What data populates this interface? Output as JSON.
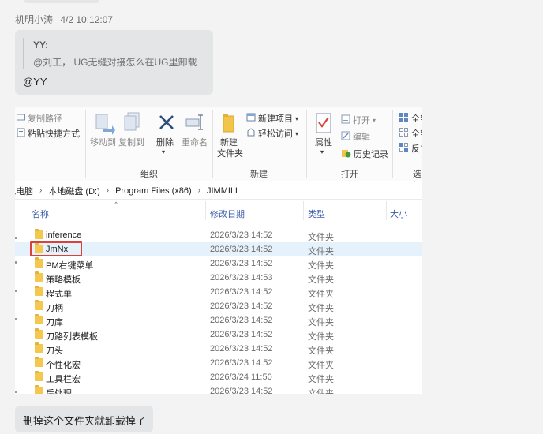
{
  "message": {
    "sender": "机明小涛",
    "time": "4/2 10:12:07",
    "quote_author": "YY:",
    "quote_text": "@刘工， UG无缝对接怎么在UG里卸载",
    "reply": "@YY"
  },
  "ribbon": {
    "copy_path": "复制路径",
    "paste_shortcut": "粘贴快捷方式",
    "move_to": "移动到",
    "copy_to": "复制到",
    "delete": "删除",
    "rename": "重命名",
    "new_item": "新建项目",
    "easy_access": "轻松访问",
    "new_folder_line1": "新建",
    "new_folder_line2": "文件夹",
    "properties": "属性",
    "open": "打开",
    "edit": "编辑",
    "history": "历史记录",
    "select_all": "全部",
    "select_none": "全部",
    "invert": "反向",
    "group_organize": "组织",
    "group_new": "新建",
    "group_open": "打开",
    "group_select": "选择"
  },
  "address": {
    "crumbs": [
      "此电脑",
      "本地磁盘 (D:)",
      "Program Files (x86)",
      "JIMMILL"
    ]
  },
  "columns": {
    "name": "名称",
    "modified": "修改日期",
    "type": "类型",
    "size": "大小"
  },
  "files": [
    {
      "name": "inference",
      "date": "2026/3/23 14:52",
      "type": "文件夹"
    },
    {
      "name": "JmNx",
      "date": "2026/3/23 14:52",
      "type": "文件夹"
    },
    {
      "name": "PM右键菜单",
      "date": "2026/3/23 14:52",
      "type": "文件夹"
    },
    {
      "name": "策略模板",
      "date": "2026/3/23 14:53",
      "type": "文件夹"
    },
    {
      "name": "程式单",
      "date": "2026/3/23 14:52",
      "type": "文件夹"
    },
    {
      "name": "刀柄",
      "date": "2026/3/23 14:52",
      "type": "文件夹"
    },
    {
      "name": "刀库",
      "date": "2026/3/23 14:52",
      "type": "文件夹"
    },
    {
      "name": "刀路列表模板",
      "date": "2026/3/23 14:52",
      "type": "文件夹"
    },
    {
      "name": "刀头",
      "date": "2026/3/23 14:52",
      "type": "文件夹"
    },
    {
      "name": "个性化宏",
      "date": "2026/3/23 14:52",
      "type": "文件夹"
    },
    {
      "name": "工具栏宏",
      "date": "2026/3/24 11:50",
      "type": "文件夹"
    },
    {
      "name": "后处理",
      "date": "2026/3/23 14:52",
      "type": "文件夹"
    }
  ],
  "followup": "删掉这个文件夹就卸载掉了"
}
